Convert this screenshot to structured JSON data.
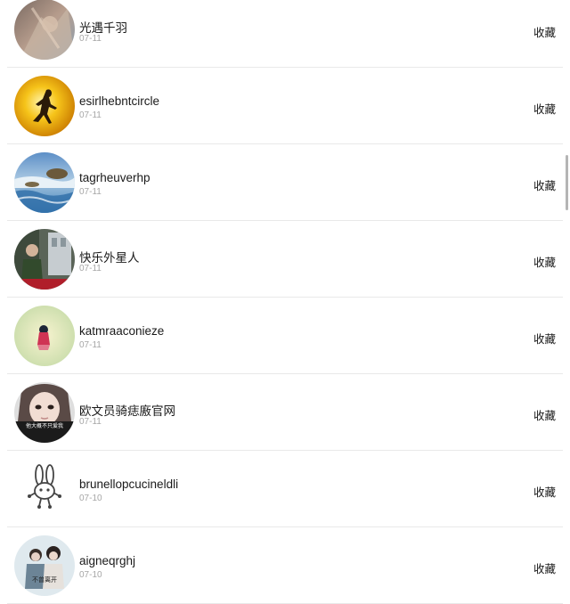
{
  "list": {
    "items": [
      {
        "name": "光遇千羽",
        "date": "07-11",
        "action": "收藏",
        "avatar_icon": "avatar-fantasy-portrait"
      },
      {
        "name": "esirlhebntcircle",
        "date": "07-11",
        "action": "收藏",
        "avatar_icon": "avatar-runner-sunset"
      },
      {
        "name": "tagrheuverhp",
        "date": "07-11",
        "action": "收藏",
        "avatar_icon": "avatar-ocean-shore"
      },
      {
        "name": "快乐外星人",
        "date": "07-11",
        "action": "收藏",
        "avatar_icon": "avatar-street-photo"
      },
      {
        "name": "katmraaconieze",
        "date": "07-11",
        "action": "收藏",
        "avatar_icon": "avatar-girl-illustration"
      },
      {
        "name": "欧文员骑痣廒官网",
        "date": "07-11",
        "action": "收藏",
        "avatar_icon": "avatar-girl-closeup",
        "avatar_caption": "他大概不只爱我"
      },
      {
        "name": "brunellopcucineldli",
        "date": "07-10",
        "action": "收藏",
        "avatar_icon": "avatar-bunny-doodle"
      },
      {
        "name": "aigneqrghj",
        "date": "07-10",
        "action": "收藏",
        "avatar_icon": "avatar-couple-photo",
        "avatar_caption": "不曾离开"
      }
    ]
  }
}
